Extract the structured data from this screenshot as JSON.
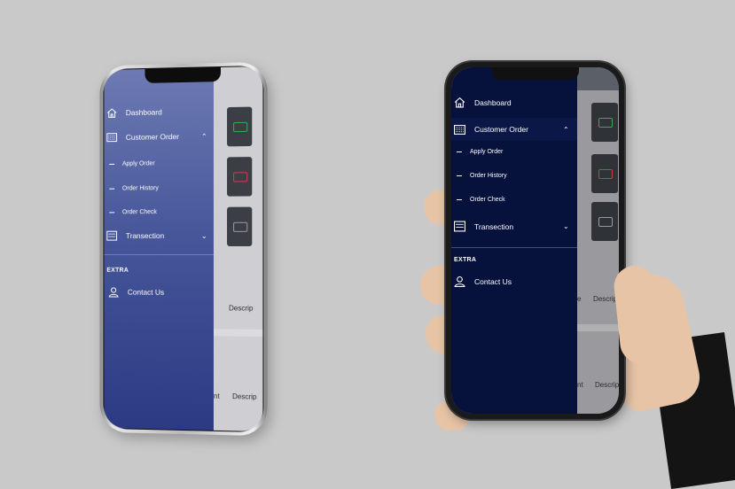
{
  "menu": {
    "dashboard": "Dashboard",
    "customer_order": "Customer Order",
    "apply_order": "Apply Order",
    "order_history": "Order History",
    "order_check": "Order Check",
    "transection": "Transection",
    "section_extra": "EXTRA",
    "contact_us": "Contact Us"
  },
  "background_table": {
    "col_partial_1": "e",
    "col_description": "Descrip",
    "col_partial_2": "nt",
    "col_description_2": "Descrip"
  },
  "colors": {
    "drawer_gradient_top": "#6d7ab3",
    "drawer_gradient_bottom": "#2b3a83",
    "drawer_dark": "#06123c",
    "status_green": "#2fae55",
    "status_red": "#d23b3b"
  },
  "icons": {
    "dashboard": "home-icon",
    "customer_order": "keyboard-icon",
    "transection": "printer-icon",
    "contact_us": "user-icon",
    "expanded": "chevron-up-icon",
    "collapsed": "chevron-down-icon"
  }
}
